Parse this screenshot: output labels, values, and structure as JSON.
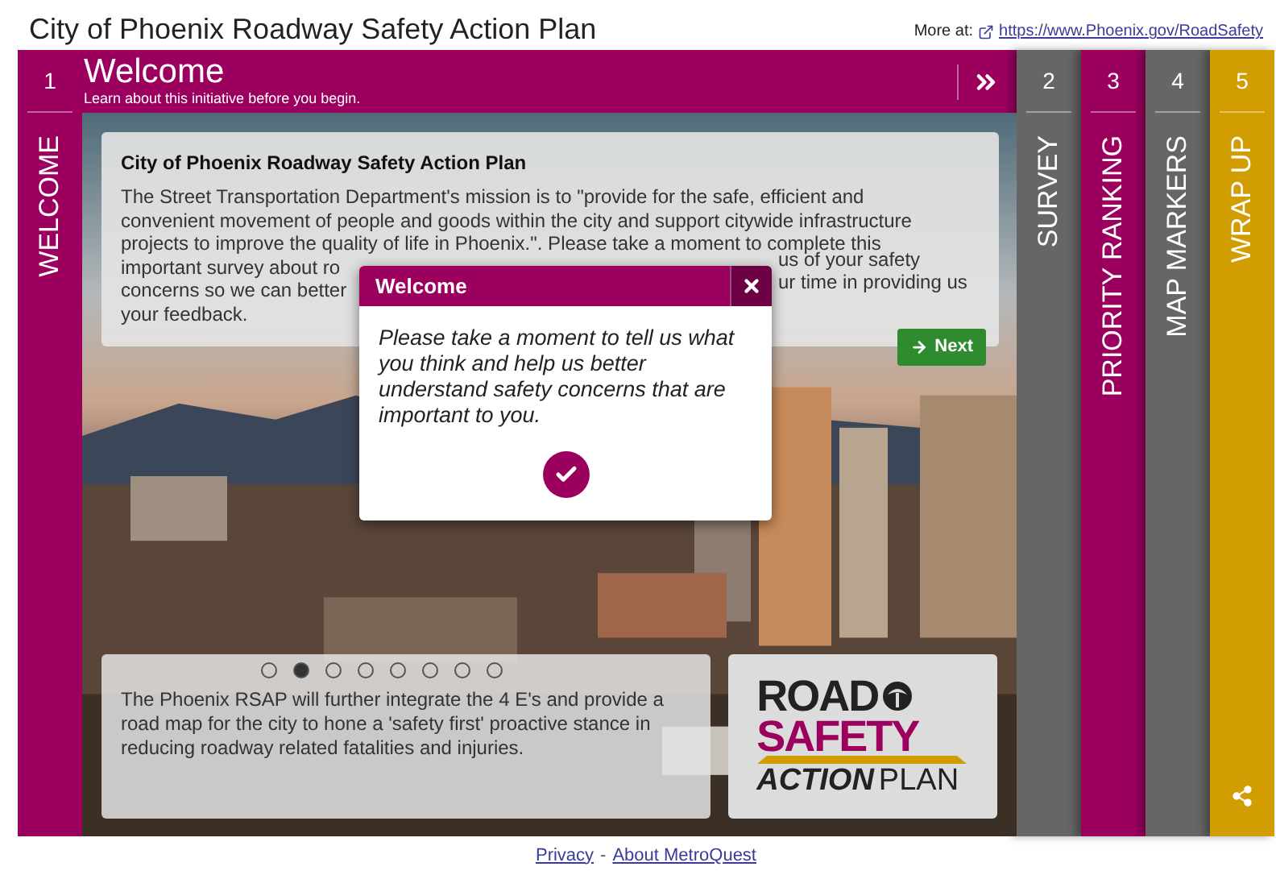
{
  "header": {
    "title": "City of Phoenix Roadway Safety Action Plan",
    "more_at": "More at:",
    "link": "https://www.Phoenix.gov/RoadSafety"
  },
  "steps": [
    {
      "number": "1",
      "label": "WELCOME",
      "color": "#9c005f",
      "selected": true
    },
    {
      "number": "2",
      "label": "SURVEY",
      "color": "#666666",
      "selected": false
    },
    {
      "number": "3",
      "label": "PRIORITY RANKING",
      "color": "#9c005f",
      "selected": false
    },
    {
      "number": "4",
      "label": "MAP MARKERS",
      "color": "#666666",
      "selected": false
    },
    {
      "number": "5",
      "label": "WRAP UP",
      "color": "#d19d00",
      "selected": false
    }
  ],
  "panel": {
    "title": "Welcome",
    "subtitle": "Learn about this initiative before you begin.",
    "intro": {
      "title": "City of Phoenix Roadway Safety Action Plan",
      "lines": [
        {
          "left": "The Street Transportation Department's mission is to \"provide for the safe, efficient and"
        },
        {
          "left": "convenient movement of people and goods within the city and support citywide infrastructure"
        },
        {
          "left": "projects to improve the quality of life in Phoenix.\". Please take a moment to complete this"
        },
        {
          "left": "important survey about ro",
          "right": "us of your safety"
        },
        {
          "left": "concerns so we can better",
          "right": "ur time in providing us"
        },
        {
          "left": "your feedback."
        }
      ],
      "next": "Next"
    },
    "dots": [
      {
        "selected": false
      },
      {
        "selected": true
      },
      {
        "selected": false
      },
      {
        "selected": false
      },
      {
        "selected": false
      },
      {
        "selected": false
      },
      {
        "selected": false
      },
      {
        "selected": false
      }
    ],
    "caption": "The Phoenix RSAP will further integrate the 4 E's and provide a road map for the city to hone a 'safety first' proactive stance in reducing roadway related fatalities and injuries.",
    "logo": {
      "line_1": "ROAD",
      "line_2": "SAFETY",
      "line_3a": "ACTION",
      "line_3b": "PLAN"
    }
  },
  "dialog": {
    "title": "Welcome",
    "message": "Please take a moment to tell us what you think and help us better understand safety concerns that are important to you."
  },
  "footer": {
    "links": [
      "Privacy",
      "About MetroQuest"
    ],
    "separator": "-"
  }
}
